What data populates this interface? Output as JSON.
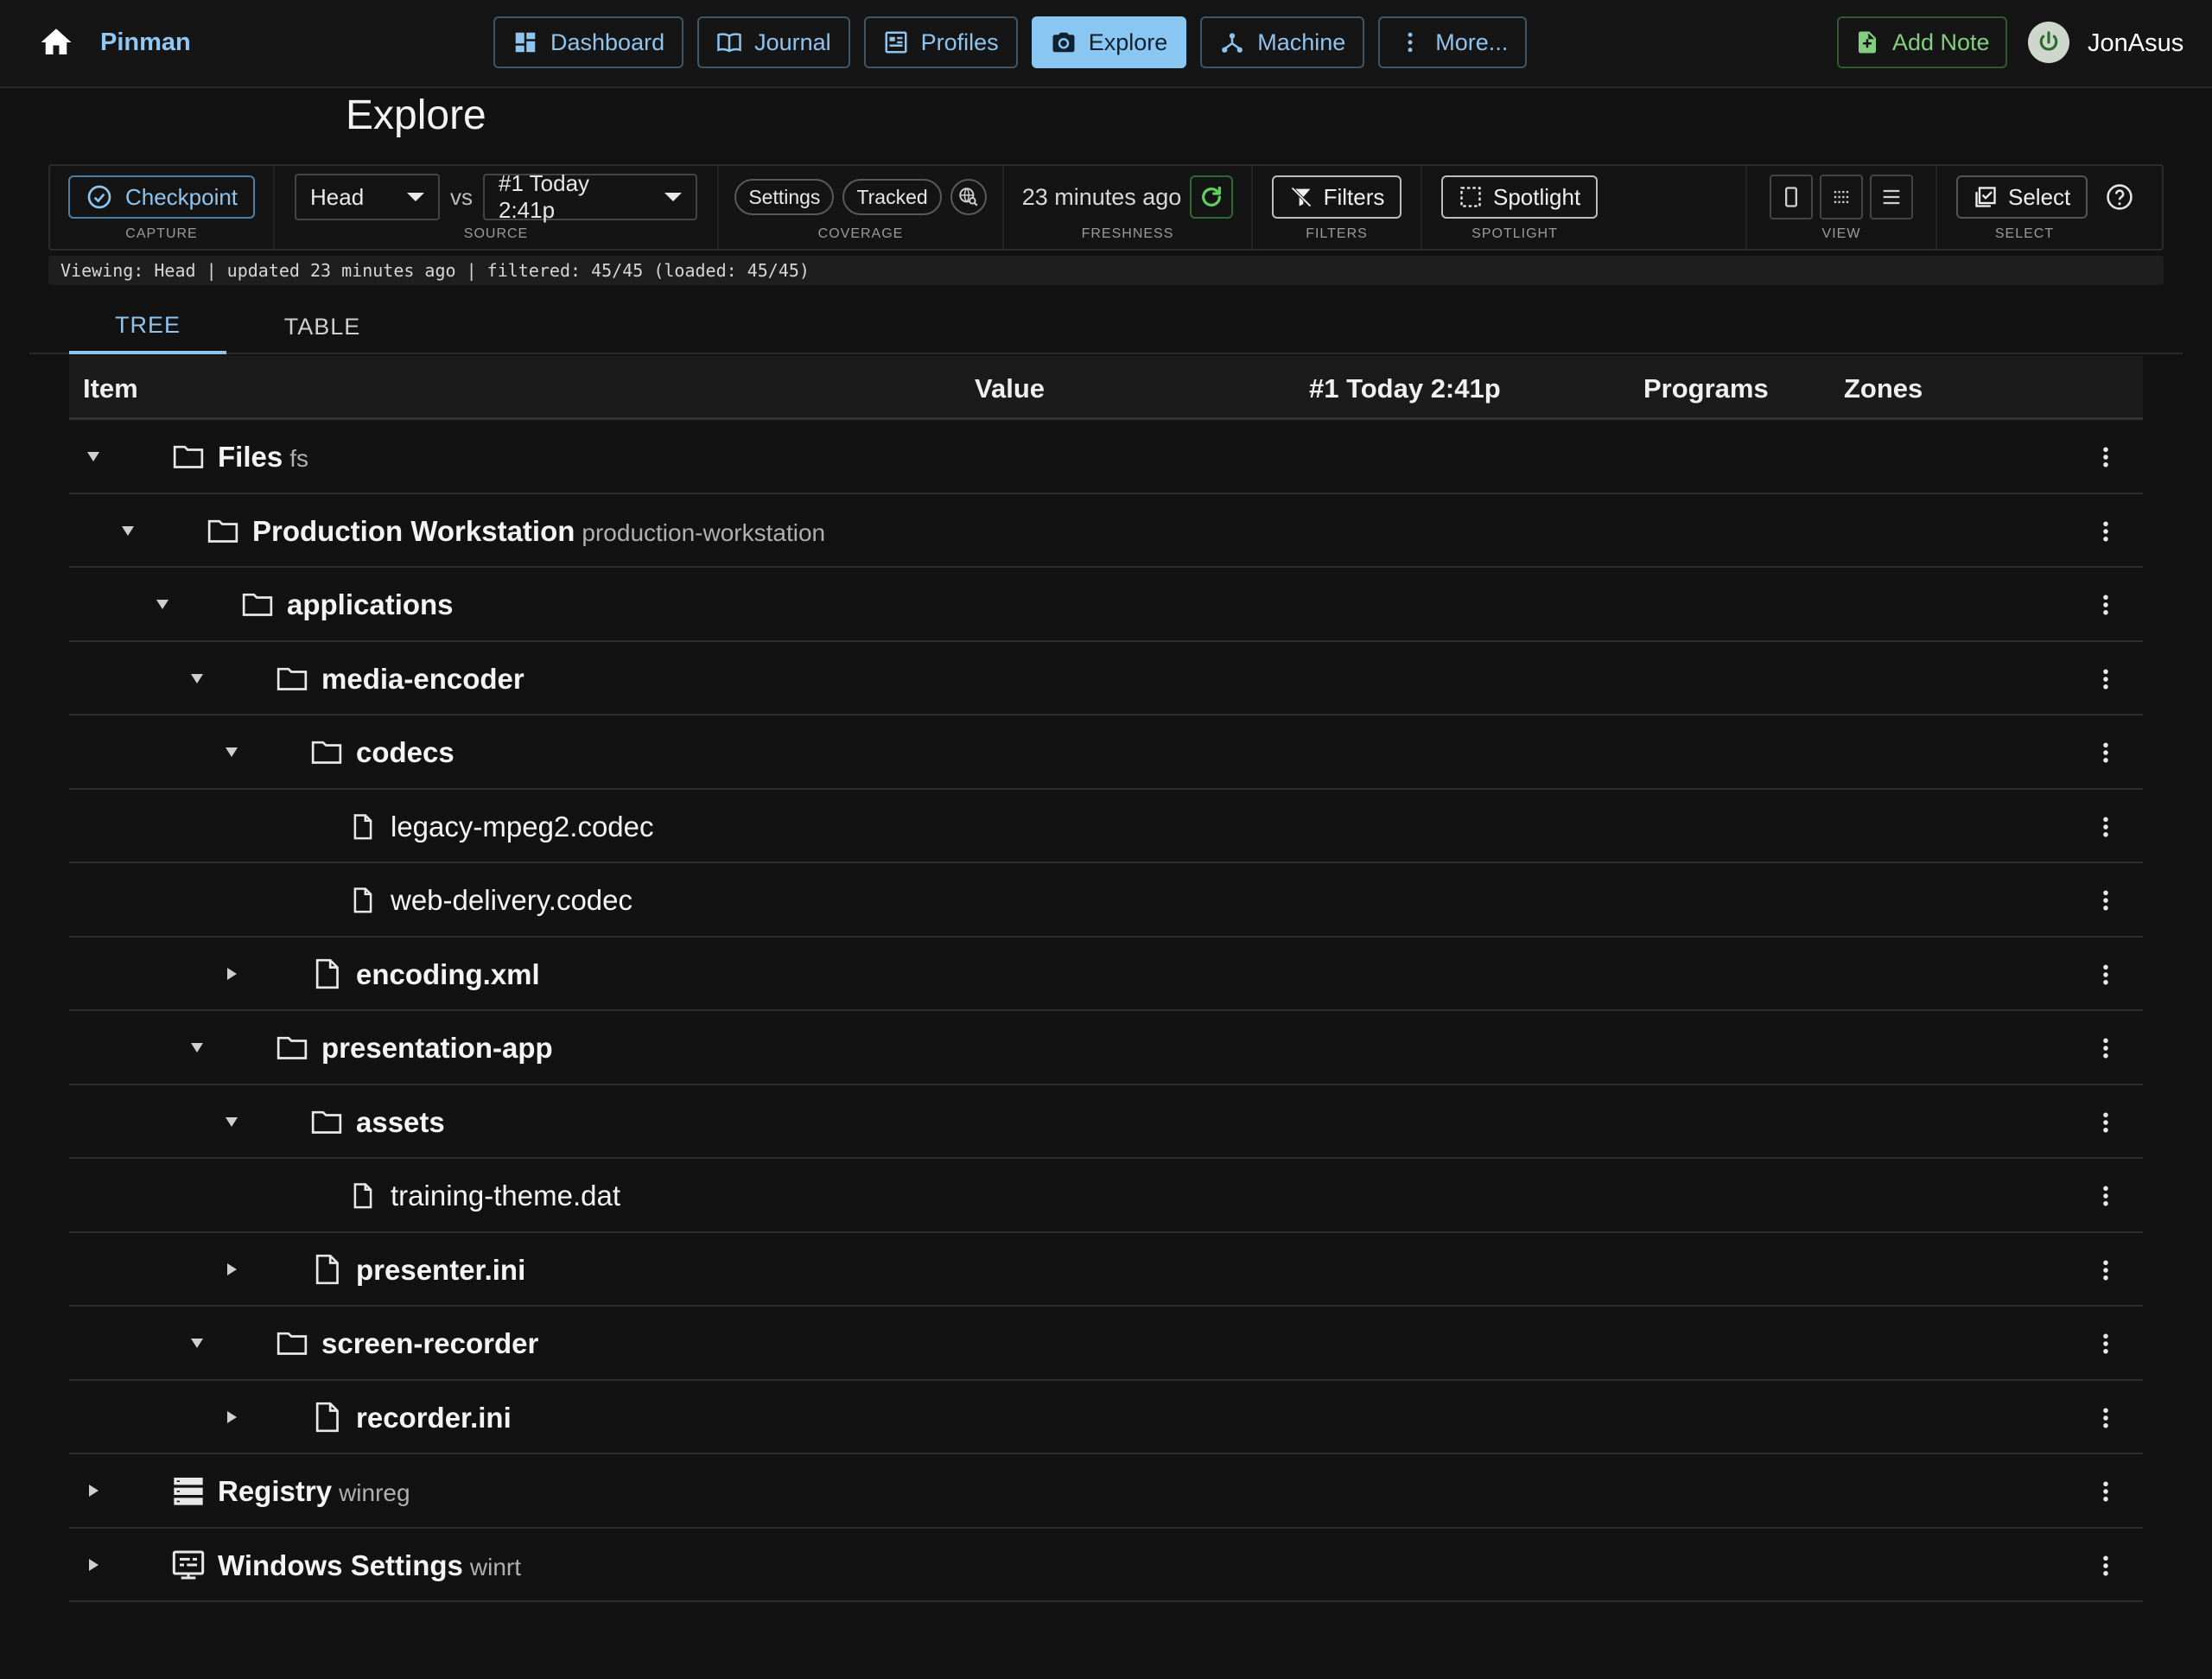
{
  "app": {
    "brand": "Pinman",
    "user": "JonAsus"
  },
  "nav": {
    "items": [
      {
        "label": "Dashboard",
        "icon": "dashboard-icon",
        "active": false
      },
      {
        "label": "Journal",
        "icon": "journal-icon",
        "active": false
      },
      {
        "label": "Profiles",
        "icon": "profiles-icon",
        "active": false
      },
      {
        "label": "Explore",
        "icon": "camera-icon",
        "active": true
      },
      {
        "label": "Machine",
        "icon": "machine-icon",
        "active": false
      },
      {
        "label": "More...",
        "icon": "more-vertical-icon",
        "active": false
      }
    ],
    "add_note": "Add Note"
  },
  "page": {
    "title": "Explore"
  },
  "toolbar": {
    "capture": {
      "button": "Checkpoint",
      "label": "CAPTURE"
    },
    "source": {
      "head": "Head",
      "vs": "vs",
      "compare": "#1 Today 2:41p",
      "label": "SOURCE"
    },
    "coverage": {
      "settings": "Settings",
      "tracked": "Tracked",
      "label": "COVERAGE"
    },
    "freshness": {
      "text": "23 minutes ago",
      "label": "FRESHNESS"
    },
    "filters": {
      "button": "Filters",
      "label": "FILTERS"
    },
    "spotlight": {
      "button": "Spotlight",
      "label": "SPOTLIGHT"
    },
    "view": {
      "label": "VIEW"
    },
    "select": {
      "button": "Select",
      "label": "SELECT"
    }
  },
  "status": "Viewing: Head | updated 23 minutes ago | filtered: 45/45 (loaded: 45/45)",
  "tabs": [
    "TREE",
    "TABLE"
  ],
  "columns": [
    "Item",
    "Value",
    "#1 Today 2:41p",
    "Programs",
    "Zones"
  ],
  "rows": [
    {
      "level": 0,
      "toggle": "expanded",
      "icon": "folder-icon",
      "name": "Files",
      "sub": "fs",
      "bold": true
    },
    {
      "level": 1,
      "toggle": "expanded",
      "icon": "folder-icon",
      "name": "Production Workstation",
      "sub": "production-workstation",
      "bold": true
    },
    {
      "level": 2,
      "toggle": "expanded",
      "icon": "folder-icon",
      "name": "applications",
      "sub": "",
      "bold": true
    },
    {
      "level": 3,
      "toggle": "expanded",
      "icon": "folder-icon",
      "name": "media-encoder",
      "sub": "",
      "bold": true
    },
    {
      "level": 4,
      "toggle": "expanded",
      "icon": "folder-icon",
      "name": "codecs",
      "sub": "",
      "bold": true
    },
    {
      "level": 5,
      "toggle": "none",
      "icon": "file-small-icon",
      "name": "legacy-mpeg2.codec",
      "sub": "",
      "bold": false
    },
    {
      "level": 5,
      "toggle": "none",
      "icon": "file-small-icon",
      "name": "web-delivery.codec",
      "sub": "",
      "bold": false
    },
    {
      "level": 4,
      "toggle": "collapsed",
      "icon": "file-icon",
      "name": "encoding.xml",
      "sub": "",
      "bold": true
    },
    {
      "level": 3,
      "toggle": "expanded",
      "icon": "folder-icon",
      "name": "presentation-app",
      "sub": "",
      "bold": true
    },
    {
      "level": 4,
      "toggle": "expanded",
      "icon": "folder-icon",
      "name": "assets",
      "sub": "",
      "bold": true
    },
    {
      "level": 5,
      "toggle": "none",
      "icon": "file-small-icon",
      "name": "training-theme.dat",
      "sub": "",
      "bold": false
    },
    {
      "level": 4,
      "toggle": "collapsed",
      "icon": "file-icon",
      "name": "presenter.ini",
      "sub": "",
      "bold": true
    },
    {
      "level": 3,
      "toggle": "expanded",
      "icon": "folder-icon",
      "name": "screen-recorder",
      "sub": "",
      "bold": true
    },
    {
      "level": 4,
      "toggle": "collapsed",
      "icon": "file-icon",
      "name": "recorder.ini",
      "sub": "",
      "bold": true
    },
    {
      "level": 0,
      "toggle": "collapsed",
      "icon": "registry-icon",
      "name": "Registry",
      "sub": "winreg",
      "bold": true
    },
    {
      "level": 0,
      "toggle": "collapsed",
      "icon": "settings-window-icon",
      "name": "Windows Settings",
      "sub": "winrt",
      "bold": true
    }
  ],
  "colors": {
    "accent": "#8ac6f2",
    "green": "#84cf7f",
    "background": "#121212"
  }
}
